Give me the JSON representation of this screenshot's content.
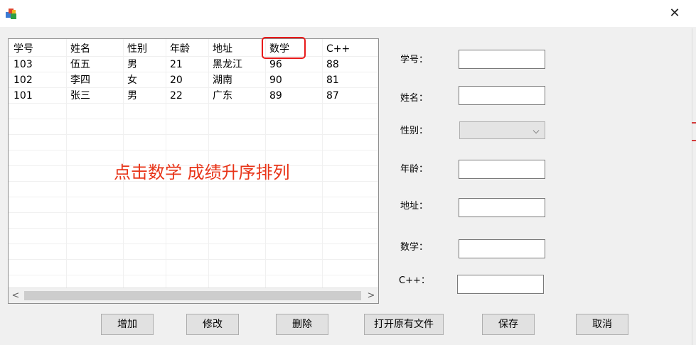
{
  "window": {
    "close_glyph": "✕"
  },
  "grid": {
    "columns": [
      "学号",
      "姓名",
      "性别",
      "年龄",
      "地址",
      "数学",
      "C++"
    ],
    "rows": [
      [
        "103",
        "伍五",
        "男",
        "21",
        "黑龙江",
        "96",
        "88"
      ],
      [
        "102",
        "李四",
        "女",
        "20",
        "湖南",
        "90",
        "81"
      ],
      [
        "101",
        "张三",
        "男",
        "22",
        "广东",
        "89",
        "87"
      ]
    ],
    "annotation": "点击数学 成绩升序排列",
    "highlight_color": "#e81a1a",
    "scroll_left": "<",
    "scroll_right": ">"
  },
  "form": {
    "id_label": "学号：",
    "name_label": "姓名：",
    "gender_label": "性别：",
    "age_label": "年龄：",
    "address_label": "地址：",
    "math_label": "数学：",
    "cpp_label": "C++：",
    "gender_chevron": "⌵"
  },
  "buttons": {
    "add": "增加",
    "edit": "修改",
    "delete": "删除",
    "open": "打开原有文件",
    "save": "保存",
    "cancel": "取消"
  }
}
